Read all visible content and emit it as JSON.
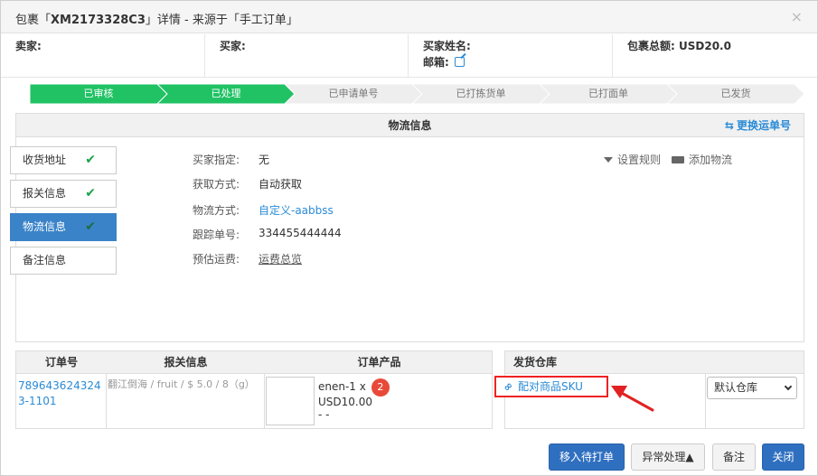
{
  "dialog": {
    "title_prefix": "包裹「",
    "package_id": "XM2173328C3",
    "title_suffix": "」详情 - 来源于「手工订单」",
    "close_glyph": "×"
  },
  "info": {
    "seller_label": "卖家:",
    "buyer_label": "买家:",
    "buyer_name_label": "买家姓名:",
    "email_label": "邮箱:",
    "total_label": "包裹总额:",
    "total_value": "USD20.0"
  },
  "steps": [
    {
      "label": "已审核",
      "done": true
    },
    {
      "label": "已处理",
      "done": true
    },
    {
      "label": "已申请单号",
      "done": false
    },
    {
      "label": "已打拣货单",
      "done": false
    },
    {
      "label": "已打面单",
      "done": false
    },
    {
      "label": "已发货",
      "done": false
    }
  ],
  "logistics": {
    "panel_title": "物流信息",
    "swap_label": "更换运单号",
    "swap_icon": "swap-arrows-icon",
    "side_tabs": [
      {
        "label": "收货地址",
        "checked": true,
        "active": false
      },
      {
        "label": "报关信息",
        "checked": true,
        "active": false
      },
      {
        "label": "物流信息",
        "checked": true,
        "active": true
      },
      {
        "label": "备注信息",
        "checked": false,
        "active": false
      }
    ],
    "fields": [
      {
        "label": "买家指定:",
        "value": "无"
      },
      {
        "label": "获取方式:",
        "value": "自动获取"
      },
      {
        "label": "物流方式:",
        "value": "自定义-aabbss"
      },
      {
        "label": "跟踪单号:",
        "value": "334455444444"
      },
      {
        "label": "预估运费:",
        "value": "运费总览"
      }
    ],
    "set_rule_label": "设置规则",
    "add_logistics_label": "添加物流"
  },
  "orders": {
    "headers": [
      "订单号",
      "报关信息",
      "订单产品"
    ],
    "order_no": "7896436243243-1101",
    "customs_info": "翻江倒海 / fruit / $ 5.0 / 8（g）",
    "product_name": "enen-1 x",
    "product_qty": "2",
    "product_price": "USD10.00",
    "product_extra": "- -"
  },
  "warehouse": {
    "header": "发货仓库",
    "match_sku_label": "配对商品SKU",
    "select_value": "默认仓库"
  },
  "footer": {
    "move_label": "移入待打单",
    "exception_label": "异常处理▲",
    "note_label": "备注",
    "close_label": "关闭"
  },
  "colors": {
    "step_done": "#20c264",
    "step_pending": "#eeeeee",
    "primary": "#2f6fc0",
    "link": "#2a8bd6",
    "highlight": "#e22222"
  }
}
